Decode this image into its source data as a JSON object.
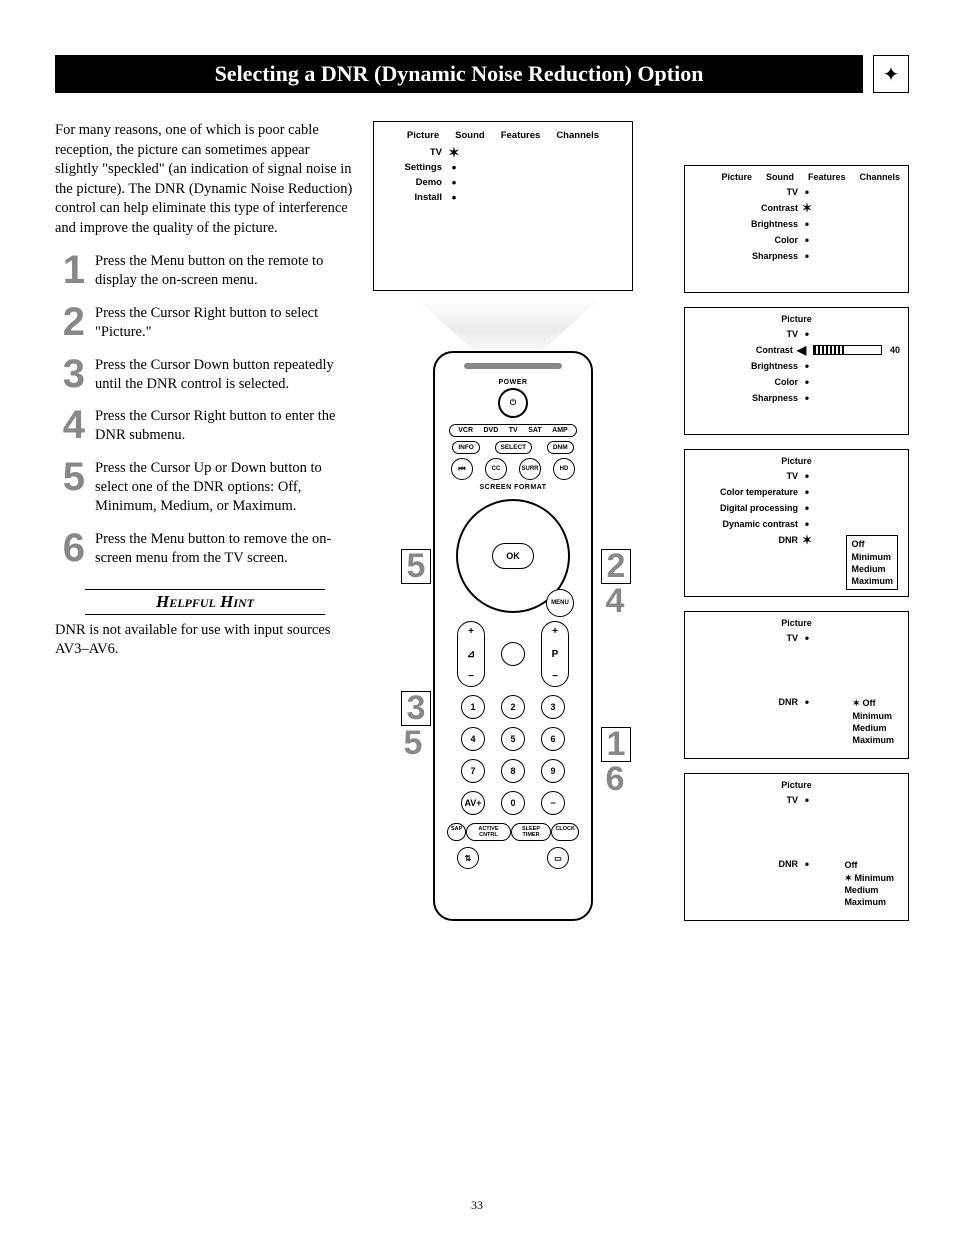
{
  "title": "Selecting a DNR (Dynamic Noise Reduction) Option",
  "intro": "For many reasons, one of which is poor cable reception, the picture can sometimes appear slightly \"speckled\" (an indication of signal noise in the picture). The DNR (Dynamic Noise Reduction) control can help eliminate this type of interference and improve the quality of the picture.",
  "steps": [
    {
      "n": "1",
      "t": "Press the Menu button on the remote to display the on-screen menu."
    },
    {
      "n": "2",
      "t": "Press the Cursor Right button to select \"Picture.\""
    },
    {
      "n": "3",
      "t": "Press the Cursor Down button repeatedly until the DNR control is selected."
    },
    {
      "n": "4",
      "t": "Press the Cursor Right button to enter the DNR submenu."
    },
    {
      "n": "5",
      "t": "Press the Cursor Up or Down button to select one of the DNR options: Off, Minimum, Medium, or Maximum."
    },
    {
      "n": "6",
      "t": "Press the Menu button to remove the on-screen menu from the TV screen."
    }
  ],
  "hint": {
    "title": "Helpful Hint",
    "body": "DNR is not available for use with input sources AV3–AV6."
  },
  "osd": {
    "tabs": [
      "Picture",
      "Sound",
      "Features",
      "Channels"
    ],
    "tv": "TV",
    "side": [
      "Settings",
      "Demo",
      "Install"
    ],
    "pic1": [
      "Contrast",
      "Brightness",
      "Color",
      "Sharpness"
    ],
    "contrast_val": "40",
    "pic3": [
      "Color temperature",
      "Digital processing",
      "Dynamic contrast",
      "DNR"
    ],
    "dnr": "DNR",
    "dnr_opts": [
      "Off",
      "Minimum",
      "Medium",
      "Maximum"
    ],
    "picture": "Picture"
  },
  "remote": {
    "power": "POWER",
    "modes": [
      "VCR",
      "DVD",
      "TV",
      "SAT",
      "AMP"
    ],
    "row_pills": [
      "INFO",
      "SELECT",
      "DNM"
    ],
    "row_circ_top": [
      "⏮",
      "CC",
      "SURR",
      "HD"
    ],
    "screen_format": "SCREEN FORMAT",
    "ok": "OK",
    "menu": "MENU",
    "vol": "⊿",
    "prog": "P",
    "nums": [
      "1",
      "2",
      "3",
      "4",
      "5",
      "6",
      "7",
      "8",
      "9",
      "AV+",
      "0",
      "−"
    ],
    "bottom": [
      "SAP",
      "ACTIVE CNTRL",
      "SLEEP TIMER",
      "CLOCK"
    ]
  },
  "callouts": {
    "c5a": "5",
    "c2": "2",
    "c4": "4",
    "c3": "3",
    "c5b": "5",
    "c1": "1",
    "c6": "6"
  },
  "page_number": "33"
}
